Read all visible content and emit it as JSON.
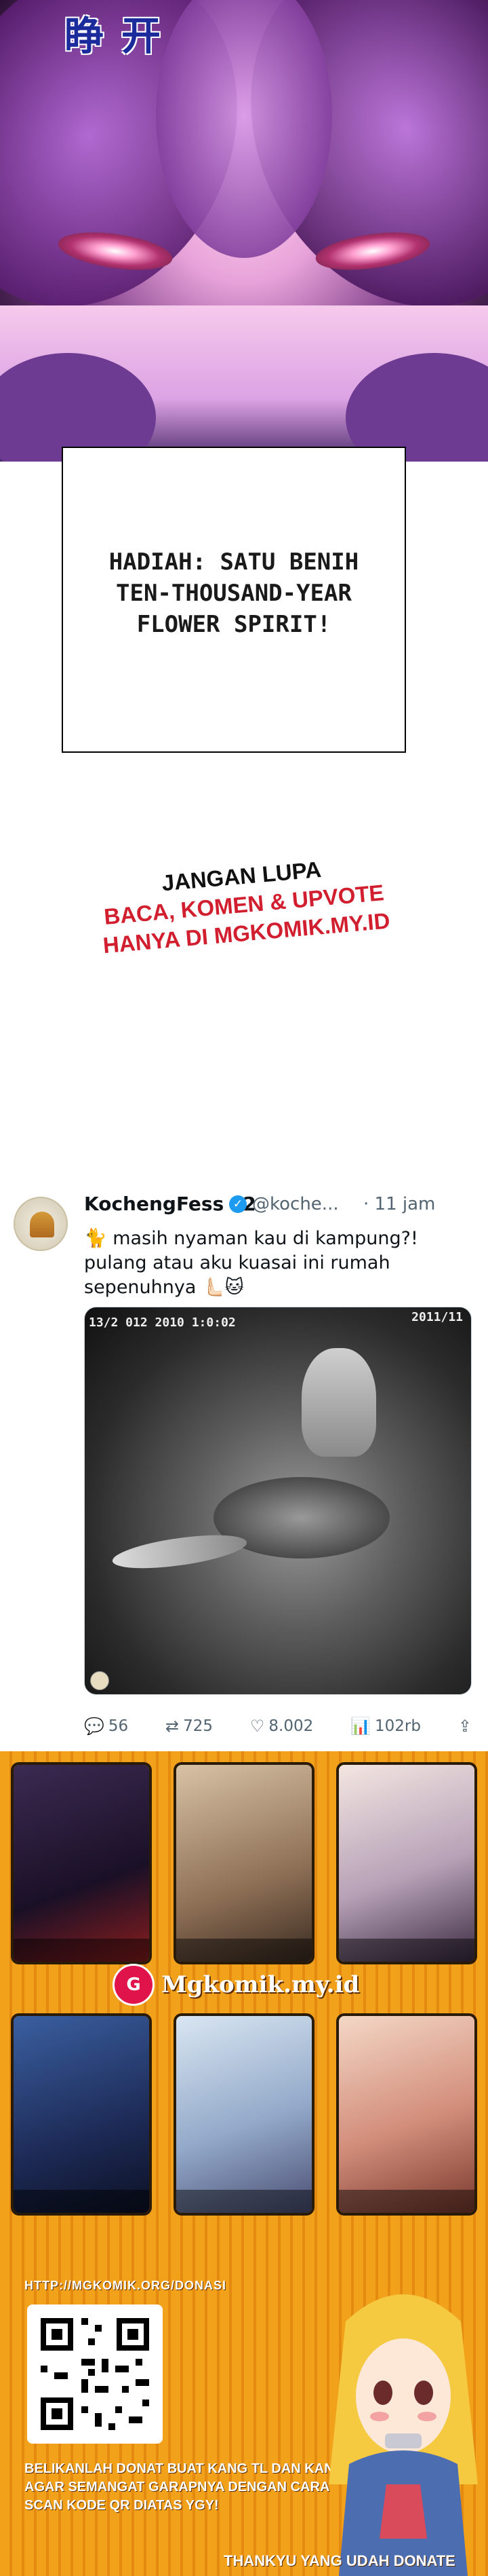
{
  "art_panel": {
    "sfx_text": "睁开"
  },
  "caption": {
    "text": "HADIAH: SATU BENIH\nTEN-THOUSAND-YEAR\nFLOWER SPIRIT!"
  },
  "reminder": {
    "line1": "JANGAN LUPA",
    "line2": "BACA, KOMEN & UPVOTE",
    "line3": "HANYA DI MGKOMIK.MY.ID"
  },
  "tweet": {
    "display_name": "KochengFess v2",
    "handle": "@koche...",
    "time": "· 11 jam",
    "text": "🐈 masih nyaman kau di kampung?! pulang atau aku kuasai ini rumah sepenuhnya 🫷🏻🐱",
    "media": {
      "timestamp_left": "13/2 012  2010 1:0:02",
      "timestamp_right": "2011/11"
    },
    "actions": {
      "replies": "56",
      "retweets": "725",
      "likes": "8.002",
      "views": "102rb"
    }
  },
  "promo": {
    "logo_mark": "G",
    "logo_text": "Mgkomik.my.id",
    "donate_url": "HTTP://MGKOMIK.ORG/DONASI",
    "donate_text": "BELIKANLAH DONAT BUAT KANG TL DAN KANG TS\nAGAR SEMANGAT GARAPNYA DENGAN CARA\nSCAN KODE QR DIATAS YGY!",
    "thanks_text": "THANKYU YANG UDAH DONATE"
  },
  "colors": {
    "sfx": "#1c2b9b",
    "reminder_red": "#d11f2f",
    "verified_blue": "#1d9bf0",
    "promo_orange": "#f2a11b"
  }
}
